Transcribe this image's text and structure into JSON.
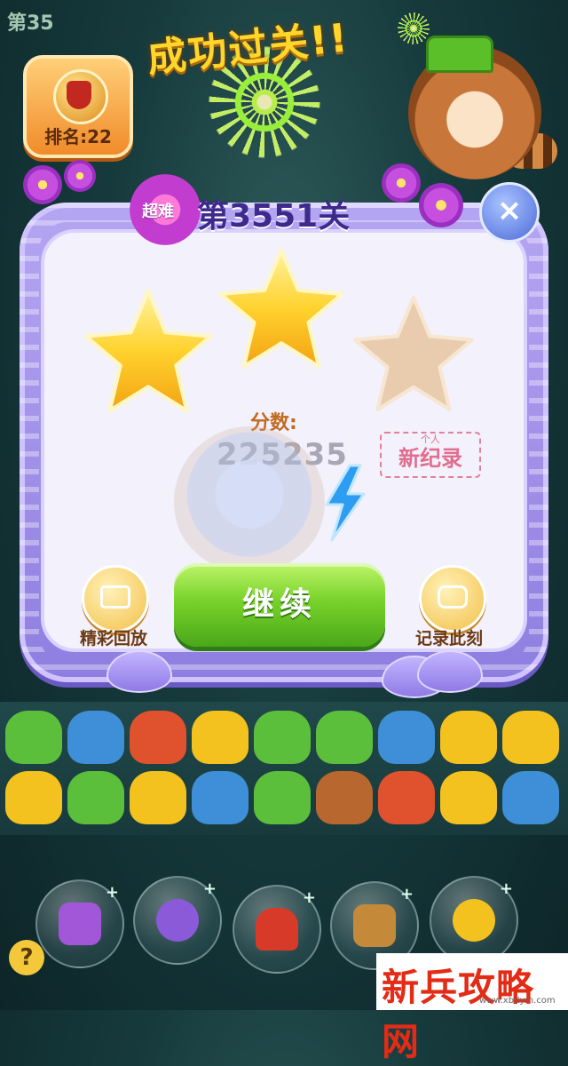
{
  "hud": {
    "level_partial": "第35",
    "rank_label": "排名:22",
    "success_title": "成功过关!!"
  },
  "popup": {
    "difficulty": "超难",
    "level": "第3551关",
    "stars_earned": 2,
    "stars_total": 3,
    "score_label": "分数:",
    "score_value": "225235",
    "record_sub": "个人",
    "record_main": "新纪录",
    "continue_label": "继续",
    "replay_label": "精彩回放",
    "record_moment_label": "记录此刻",
    "close_glyph": "×"
  },
  "colors": {
    "star_gold": "#ffc21f",
    "star_empty": "#e6c8a6",
    "button_green": "#78d22a",
    "panel_purple": "#9e8fe8"
  },
  "board": {
    "rows": [
      [
        "frog",
        "blue",
        "fox",
        "chick",
        "frog",
        "frog",
        "blue",
        "chick",
        "chick"
      ],
      [
        "chick",
        "frog",
        "chick",
        "blue",
        "frog",
        "bear",
        "fox",
        "chick",
        "blue"
      ]
    ]
  },
  "boosters": [
    {
      "icon": "swap-icon"
    },
    {
      "icon": "rocket-icon"
    },
    {
      "icon": "bomb-icon"
    },
    {
      "icon": "hammer-icon"
    },
    {
      "icon": "star-wand-icon"
    }
  ],
  "watermark": {
    "text": "新兵攻略网",
    "url": "www.xbdym.com"
  }
}
